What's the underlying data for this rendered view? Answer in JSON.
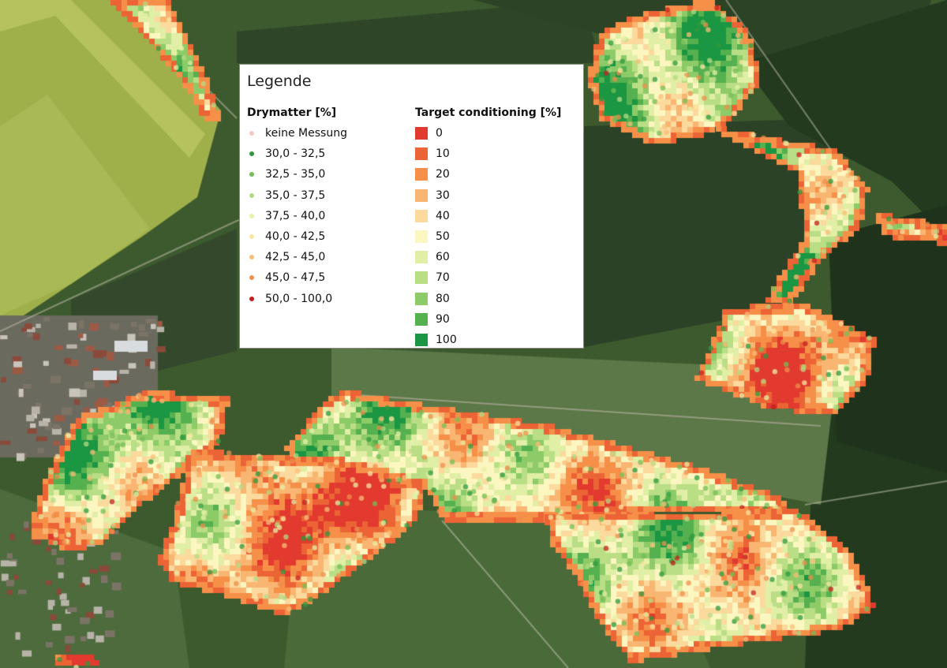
{
  "legend": {
    "title": "Legende",
    "drymatter_title": "Drymatter [%]",
    "drymatter_items": [
      {
        "label": "keine Messung",
        "color": "#f6c9c4"
      },
      {
        "label": "30,0 - 32,5",
        "color": "#2e9a3e"
      },
      {
        "label": "32,5 - 35,0",
        "color": "#74be55"
      },
      {
        "label": "35,0 - 37,5",
        "color": "#b5da86"
      },
      {
        "label": "37,5 - 40,0",
        "color": "#e7f2a7"
      },
      {
        "label": "40,0 - 42,5",
        "color": "#fbe7a2"
      },
      {
        "label": "42,5 - 45,0",
        "color": "#f8be78"
      },
      {
        "label": "45,0 - 47,5",
        "color": "#ee8f4d"
      },
      {
        "label": "50,0 - 100,0",
        "color": "#c2201e"
      }
    ],
    "target_title": "Target conditioning [%]",
    "target_items": [
      {
        "label": "0",
        "color": "#e23a2e"
      },
      {
        "label": "10",
        "color": "#ec6435"
      },
      {
        "label": "20",
        "color": "#f69049"
      },
      {
        "label": "30",
        "color": "#f9b672"
      },
      {
        "label": "40",
        "color": "#fcd99c"
      },
      {
        "label": "50",
        "color": "#fcf7c0"
      },
      {
        "label": "60",
        "color": "#e0efa5"
      },
      {
        "label": "70",
        "color": "#b9de86"
      },
      {
        "label": "80",
        "color": "#8ccb68"
      },
      {
        "label": "90",
        "color": "#55b04f"
      },
      {
        "label": "100",
        "color": "#1b9642"
      }
    ]
  }
}
